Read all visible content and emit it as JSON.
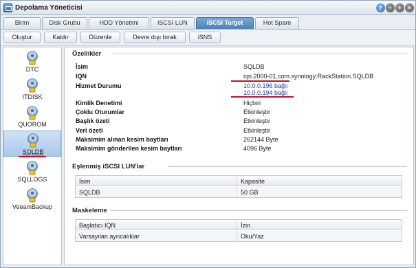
{
  "window": {
    "title": "Depolama Yöneticisi"
  },
  "title_buttons": {
    "help": "?",
    "minimize": "–",
    "maximize": "+",
    "close": "×"
  },
  "tabs": [
    {
      "label": "Birim"
    },
    {
      "label": "Disk Grubu"
    },
    {
      "label": "HDD Yönetimi"
    },
    {
      "label": "iSCSI LUN"
    },
    {
      "label": "iSCSI Target",
      "active": true
    },
    {
      "label": "Hot Spare"
    }
  ],
  "toolbar": {
    "create": "Oluştur",
    "remove": "Kaldır",
    "edit": "Düzenle",
    "disable": "Devre dışı bırak",
    "isns": "iSNS"
  },
  "sidebar": {
    "items": [
      {
        "label": "DTC",
        "icon": "disk-icon"
      },
      {
        "label": "ITDISK",
        "icon": "disk-icon"
      },
      {
        "label": "QUOROM",
        "icon": "disk-icon"
      },
      {
        "label": "SQLDB",
        "icon": "disk-icon",
        "selected": true
      },
      {
        "label": "SQLLOGS",
        "icon": "disk-icon"
      },
      {
        "label": "VeeamBackup",
        "icon": "disk-icon"
      }
    ]
  },
  "properties": {
    "title": "Özellikler",
    "rows": [
      {
        "label": "İsim",
        "value": "SQLDB"
      },
      {
        "label": "IQN",
        "value": "iqn.2000-01.com.synology:RackStation.SQLDB"
      },
      {
        "label": "Hizmet Durumu",
        "value": "10.0.0.196 bağlı",
        "value2": "10.0.0.194 bağlı"
      },
      {
        "label": "Kimlik Denetimi",
        "value": "Hiçbiri"
      },
      {
        "label": "Çoklu Oturumlar",
        "value": "Etkinleştir"
      },
      {
        "label": "Başlık özeti",
        "value": "Etkinleştir"
      },
      {
        "label": "Veri özeti",
        "value": "Etkinleştir"
      },
      {
        "label": "Maksimim alınan kesim baytları",
        "value": "262144 Byte"
      },
      {
        "label": "Maksimim gönderilen kesim baytları",
        "value": "4096 Byte"
      }
    ]
  },
  "mapped_luns": {
    "title": "Eşlenmiş iSCSI LUN'lar",
    "columns": [
      "İsim",
      "Kapasite"
    ],
    "rows": [
      [
        "SQLDB",
        "50 GB"
      ]
    ]
  },
  "masking": {
    "title": "Maskeleme",
    "columns": [
      "Başlatıcı IQN",
      "İzin"
    ],
    "rows": [
      [
        "Varsayılan ayrıcalıklar",
        "Oku/Yaz"
      ]
    ]
  },
  "colors": {
    "accent": "#4a7fb4",
    "link": "#1a3fb0",
    "annotation_red": "#c1121f"
  }
}
